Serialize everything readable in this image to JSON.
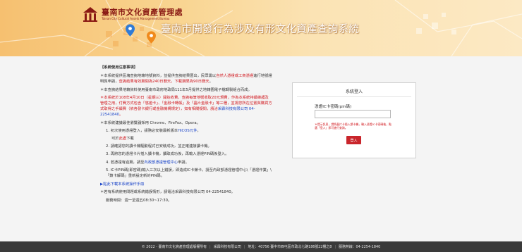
{
  "header": {
    "logo_cn": "臺南市文化資產管理處",
    "logo_en": "Tainan City Cultural Assets Management Bureau",
    "site_title": "臺南市開發行為涉及有形文化資產查詢系統"
  },
  "notice": {
    "title": "【系統使用注意事項】",
    "p1_pre": "＊本系統提供區塊查詢地籍地號資料，並提供查詢結果匯出，民眾需以",
    "p1_red1": "自然人憑證或工商憑證",
    "p1_mid": "進行地號證明與申請，",
    "p1_red2": "查詢結果有效期間為240日曆天，下載期限為90日曆天",
    "p1_end": "。",
    "p2": "＊本查詢結果地籍資料使用臺南市政府地政局111年5月提供之地籍圖電子檔轉製組合而成。",
    "p3_red": "＊本系統於108年4月10日（星期三）開始收費，查詢每筆地號收取20元規費，作為本系統持續維護及管理之用，付費方式包含「悠遊卡」、「金融卡轉帳」及「晶片金融卡」等三種，並視您所在位置與購買方式取得之手續費（依各發卡銀行或金融機構規定），如有相關疑問，請洽",
    "p3_company": "采霖科技有限公司 04-22541840",
    "p3_end": "。",
    "p4": "＊本系統建議最佳瀏覽器採用 Chrome、FireFox、Opera。",
    "s1_pre": "1. 初次使用憑證登入，請務必安裝最新版本",
    "s1_link": "HiCOS元件",
    "s1_end": "，",
    "s1_sub_pre": "可於",
    "s1_sub_link": "此處",
    "s1_sub_end": "下載",
    "s2": "2. 請確認您的讀卡機驅動程式已安裝成功，並正確連接讀卡機。",
    "s3": "3. 再將您的憑證卡片插入讀卡機，讀取成功後，再輸入憑證PIN碼後登入。",
    "s4_pre": "4. 若憑證有過期，請至",
    "s4_link": "內政部憑證管理中心",
    "s4_end": "申請。",
    "s5": "5. IC卡PIN碼(即密碼)輸入三次以上錯誤，即造成IC卡鎖卡，請至內政部憑證管理中心\\「憑證作業」\\「鎖卡解碼」重新設定新的PIN碼。",
    "manual_link": "▶點此下載本系統操作手冊",
    "contact": "＊若有系統使用問題或系統錯誤情形，請電洽采霖科技有限公司 04-22541840。",
    "hours": "服務時間：週一至週五08:30~17:30。"
  },
  "login": {
    "title": "系統登入",
    "pin_label": "憑證IC卡密碼(pin碼)",
    "pin_value": "",
    "pin_placeholder": "",
    "note": "＊提示訊息，請將晶片卡插入讀卡機，輸入憑證IC卡密碼後，點選「登入」即可進行查詢。",
    "button": "登入"
  },
  "footer": {
    "copyright": "© 2022 - 臺南市文化資產管理處版權所有",
    "company": "采霖科技有限公司",
    "address": "地址：40756 臺中市西屯區市政北七路186號22樓之8",
    "phone": "服務熱線：04-2254-1840"
  },
  "colors": {
    "accent": "#c9252b",
    "footer_bg": "#3a3a3a",
    "header_from": "#f6c070",
    "header_to": "#fce9c4"
  }
}
